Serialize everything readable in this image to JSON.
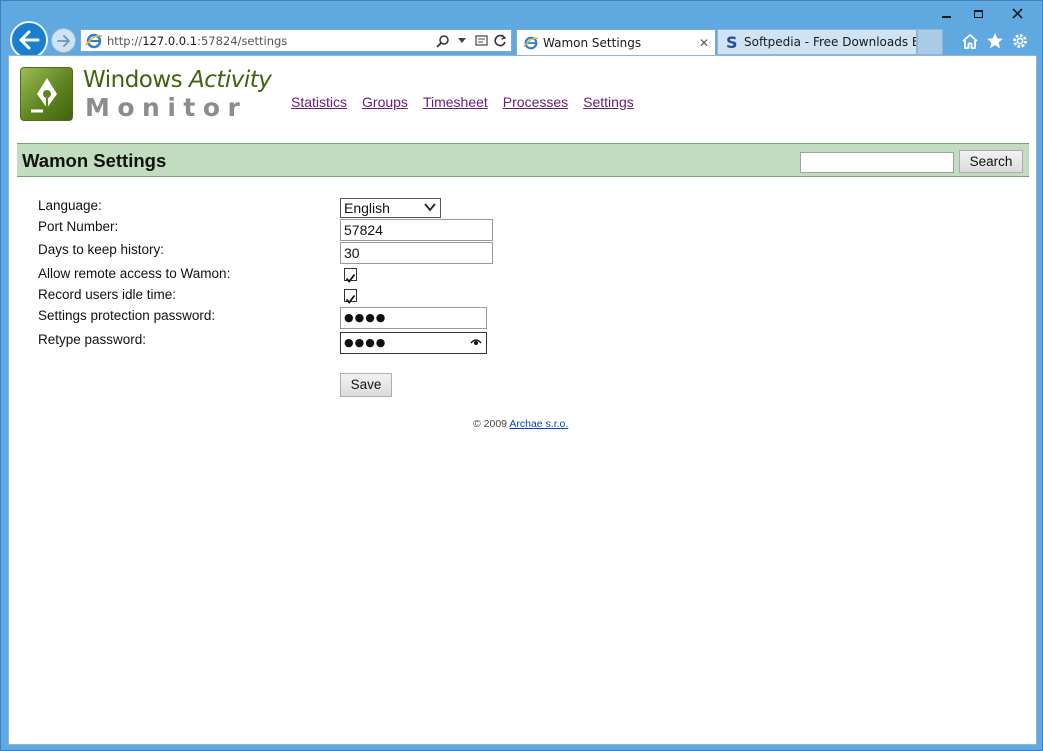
{
  "browser": {
    "url_prefix": "http://",
    "url_host": "127.0.0.1",
    "url_path": ":57824/settings",
    "tabs": [
      {
        "title": "Wamon Settings"
      },
      {
        "title": "Softpedia - Free Downloads En..."
      }
    ],
    "tab_close_glyph": "✕"
  },
  "logo": {
    "line1_a": "Windows ",
    "line1_b": "Activity",
    "line2": "Monitor"
  },
  "menu": {
    "items": [
      "Statistics",
      "Groups",
      "Timesheet",
      "Processes",
      "Settings"
    ]
  },
  "header": {
    "title": "Wamon Settings",
    "search_button": "Search",
    "search_value": ""
  },
  "form": {
    "language_label": "Language:",
    "language_value": "English",
    "port_label": "Port Number:",
    "port_value": "57824",
    "history_label": "Days to keep history:",
    "history_value": "30",
    "remote_label": "Allow remote access to Wamon:",
    "remote_checked": true,
    "idle_label": "Record users idle time:",
    "idle_checked": true,
    "password_label": "Settings protection password:",
    "password_value": "●●●●",
    "retype_label": "Retype password:",
    "retype_value": "●●●●",
    "save_label": "Save"
  },
  "footer": {
    "copyright": "© 2009 ",
    "link": "Archae s.r.o."
  },
  "colors": {
    "header_bar": "#c2dcc0",
    "menu_link": "#6b1a7d",
    "logo_green": "#3f6410",
    "browser_frame": "#60a8e0"
  }
}
